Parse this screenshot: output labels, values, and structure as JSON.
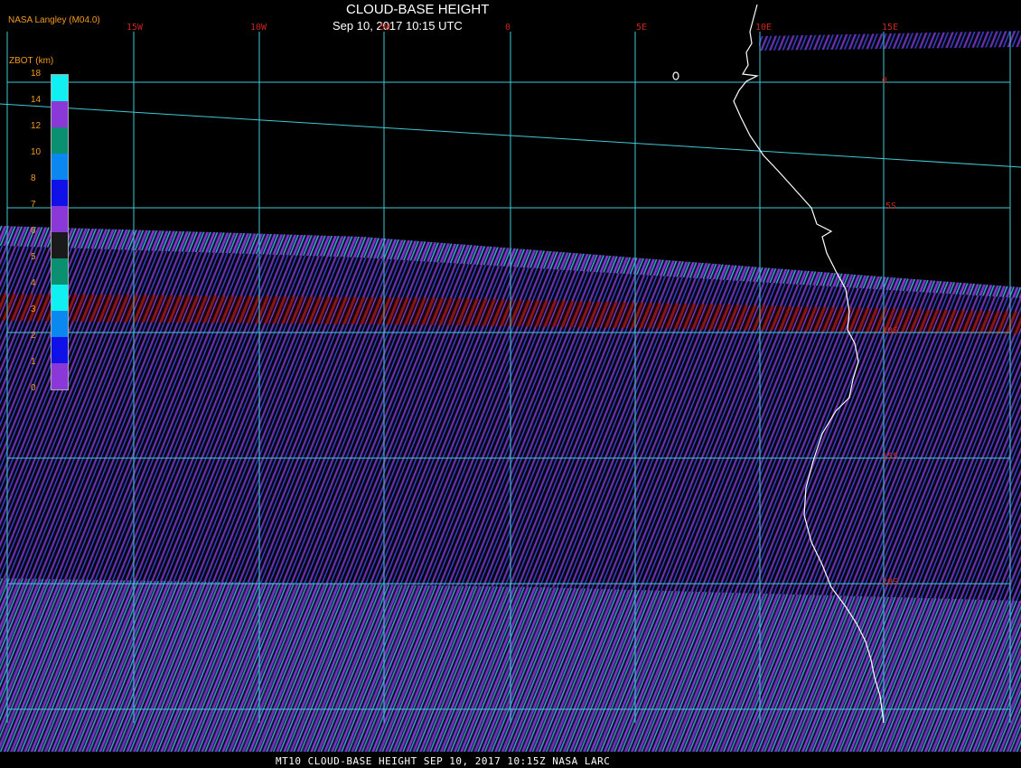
{
  "header": {
    "title": "CLOUD-BASE HEIGHT",
    "subtitle": "Sep 10, 2017 10:15 UTC",
    "credit": "NASA Langley (M04.0)"
  },
  "footer": {
    "text": "MT10  CLOUD-BASE HEIGHT   SEP 10, 2017 10:15Z   NASA LARC"
  },
  "longitude_labels": [
    "15W",
    "10W",
    "5W",
    "0",
    "5E",
    "10E",
    "15E"
  ],
  "latitude_labels": [
    "0",
    "5S",
    "10S",
    "15S",
    "20S"
  ],
  "colorbar": {
    "title": "ZBOT (km)",
    "labels": [
      "18",
      "14",
      "12",
      "10",
      "8",
      "7",
      "6",
      "5",
      "4",
      "3",
      "2",
      "1",
      "0"
    ],
    "segments_top_to_bottom": [
      "#11f0f0",
      "#8a38d8",
      "#0a9070",
      "#0a88f0",
      "#1010e8",
      "#8a38d8",
      "#1a1a1a",
      "#0a9070",
      "#11f0f0",
      "#0a88f0",
      "#1010e8",
      "#8a38d8"
    ]
  },
  "colors": {
    "grid": "#3ecad8",
    "coastline": "#ffffff",
    "label_red": "#c8261e",
    "label_orange": "#f39a1e",
    "stripe_purple": "#7a3ad0",
    "stripe_blue": "#3a4ae8",
    "stripe_red": "#8a1414",
    "stripe_cyan": "#2ab8c8"
  }
}
